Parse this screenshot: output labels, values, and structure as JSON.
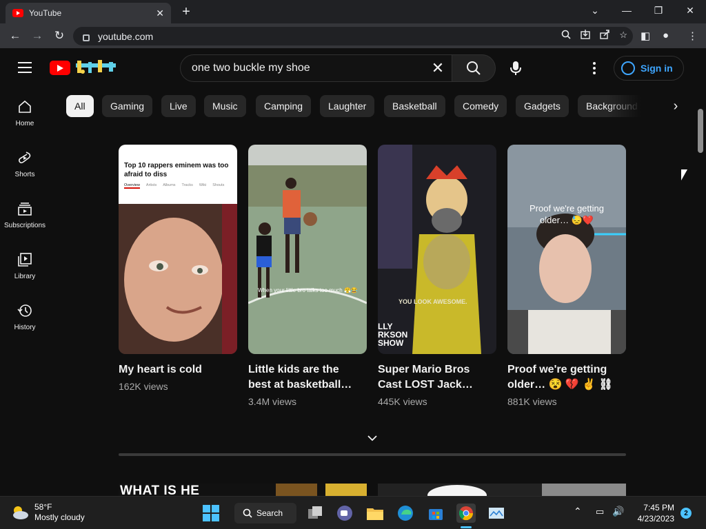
{
  "browser": {
    "tab_title": "YouTube",
    "url": "youtube.com"
  },
  "youtube": {
    "search_query": "one two buckle my shoe",
    "signin_label": "Sign in",
    "sidebar": [
      {
        "label": "Home",
        "icon": "home-icon"
      },
      {
        "label": "Shorts",
        "icon": "shorts-icon"
      },
      {
        "label": "Subscriptions",
        "icon": "subscriptions-icon"
      },
      {
        "label": "Library",
        "icon": "library-icon"
      },
      {
        "label": "History",
        "icon": "history-icon"
      }
    ],
    "chips": [
      "All",
      "Gaming",
      "Live",
      "Music",
      "Camping",
      "Laughter",
      "Basketball",
      "Comedy",
      "Gadgets",
      "Background m"
    ],
    "active_chip": "All",
    "shorts": [
      {
        "title": "My heart is cold",
        "views": "162K views",
        "overlay_text": "Top 10 rappers eminem was too afraid to diss",
        "tabs": [
          "Overview",
          "Artists",
          "Albums",
          "Tracks",
          "Wiki",
          "Shouts"
        ]
      },
      {
        "title_line1": "Little kids are the",
        "title_line2": "best at basketball…",
        "views": "3.4M views",
        "caption": "When your little bro talks too much 😤😂"
      },
      {
        "title_line1": "Super Mario Bros",
        "title_line2": "Cast LOST Jack…",
        "views": "445K views",
        "caption": "YOU LOOK AWESOME.",
        "logo_line1": "LLY",
        "logo_line2": "RKSON",
        "logo_line3": "SHOW"
      },
      {
        "title_line1": "Proof we're getting",
        "title_line2": "older… 😵 💔 ✌ ⛓",
        "views": "881K views",
        "caption_line1": "Proof we're getting",
        "caption_line2": "older… 😓❤️"
      }
    ],
    "next_section_text": "WHAT IS HE"
  },
  "taskbar": {
    "temperature": "58°F",
    "weather": "Mostly cloudy",
    "search_label": "Search",
    "time": "7:45 PM",
    "date": "4/23/2023",
    "notifications": "2"
  },
  "colors": {
    "accent": "#3ea6ff",
    "brand_red": "#ff0000",
    "background": "#0f0f0f"
  }
}
